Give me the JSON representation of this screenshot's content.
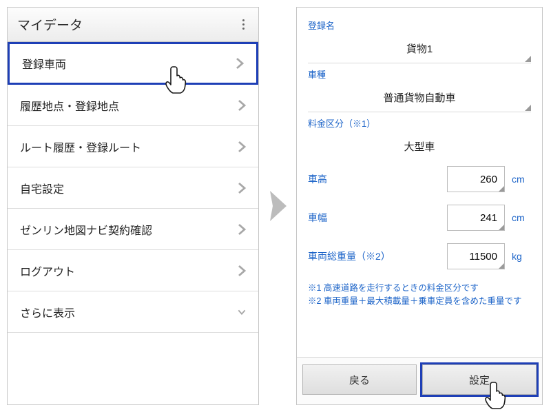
{
  "left_panel": {
    "title": "マイデータ",
    "items": [
      {
        "label": "登録車両",
        "selected": true
      },
      {
        "label": "履歴地点・登録地点",
        "selected": false
      },
      {
        "label": "ルート履歴・登録ルート",
        "selected": false
      },
      {
        "label": "自宅設定",
        "selected": false
      },
      {
        "label": "ゼンリン地図ナビ契約確認",
        "selected": false
      },
      {
        "label": "ログアウト",
        "selected": false
      },
      {
        "label": "さらに表示",
        "selected": false,
        "expand": true
      }
    ]
  },
  "right_panel": {
    "reg_name_label": "登録名",
    "reg_name_value": "貨物1",
    "vehicle_type_label": "車種",
    "vehicle_type_value": "普通貨物自動車",
    "fare_class_label": "料金区分（※1）",
    "fare_class_value": "大型車",
    "height_label": "車高",
    "height_value": "260",
    "height_unit": "cm",
    "width_label": "車幅",
    "width_value": "241",
    "width_unit": "cm",
    "gross_label": "車両総重量（※2）",
    "gross_value": "11500",
    "gross_unit": "kg",
    "note1": "※1 高速道路を走行するときの料金区分です",
    "note2": "※2 車両重量＋最大積載量＋乗車定員を含めた重量です",
    "back_label": "戻る",
    "set_label": "設定"
  }
}
